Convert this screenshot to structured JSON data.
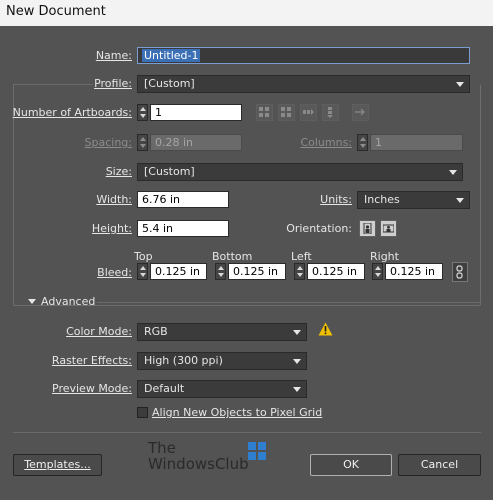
{
  "window": {
    "title": "New Document"
  },
  "name": {
    "label": "Name:",
    "value": "Untitled-1"
  },
  "profile": {
    "label": "Profile:",
    "value": "[Custom]"
  },
  "artboards": {
    "label": "Number of Artboards:",
    "value": "1"
  },
  "spacing": {
    "label": "Spacing:",
    "value": "0.28 in"
  },
  "columns": {
    "label": "Columns:",
    "value": "1"
  },
  "size": {
    "label": "Size:",
    "value": "[Custom]"
  },
  "width": {
    "label": "Width:",
    "value": "6.76 in"
  },
  "units": {
    "label": "Units:",
    "value": "Inches"
  },
  "height": {
    "label": "Height:",
    "value": "5.4 in"
  },
  "orientation": {
    "label": "Orientation:"
  },
  "bleed": {
    "label": "Bleed:",
    "top_label": "Top",
    "top_value": "0.125 in",
    "bottom_label": "Bottom",
    "bottom_value": "0.125 in",
    "left_label": "Left",
    "left_value": "0.125 in",
    "right_label": "Right",
    "right_value": "0.125 in"
  },
  "advanced": {
    "label": "Advanced",
    "color_mode": {
      "label": "Color Mode:",
      "value": "RGB"
    },
    "raster_effects": {
      "label": "Raster Effects:",
      "value": "High (300 ppi)"
    },
    "preview_mode": {
      "label": "Preview Mode:",
      "value": "Default"
    },
    "align_pixel_grid": {
      "label": "Align New Objects to Pixel Grid",
      "checked": false
    }
  },
  "footer": {
    "templates_label": "Templates...",
    "ok_label": "OK",
    "cancel_label": "Cancel"
  },
  "watermark": {
    "line1": "The",
    "line2": "WindowsClub"
  },
  "colors": {
    "warning": "#f0c000",
    "panel": "#535353",
    "name_highlight": "#3b6fb6"
  }
}
